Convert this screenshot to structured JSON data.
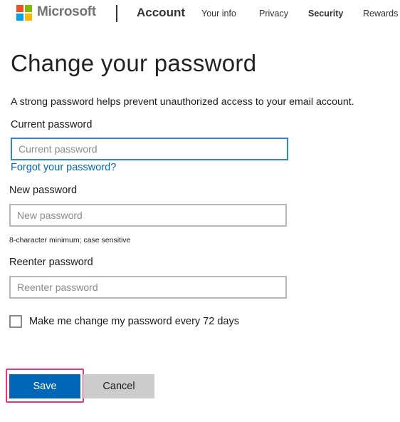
{
  "header": {
    "brand": "Microsoft",
    "section": "Account",
    "nav": [
      {
        "label": "Your info"
      },
      {
        "label": "Privacy"
      },
      {
        "label": "Security",
        "active": true
      },
      {
        "label": "Rewards"
      }
    ]
  },
  "page": {
    "title": "Change your password",
    "intro": "A strong password helps prevent unauthorized access to your email account."
  },
  "form": {
    "current": {
      "label": "Current password",
      "placeholder": "Current password",
      "value": ""
    },
    "forgot_link": "Forgot your password?",
    "new": {
      "label": "New password",
      "placeholder": "New password",
      "value": "",
      "hint": "8-character minimum; case sensitive"
    },
    "reenter": {
      "label": "Reenter password",
      "placeholder": "Reenter password",
      "value": ""
    },
    "expire_checkbox": {
      "label": "Make me change my password every 72 days",
      "checked": false
    },
    "save_label": "Save",
    "cancel_label": "Cancel"
  },
  "colors": {
    "accent": "#0067b8",
    "focus_border": "#2b88d8",
    "highlight": "#e8367a",
    "cancel_bg": "#cccccc",
    "logo": [
      "#f25022",
      "#7fba00",
      "#00a4ef",
      "#ffb900"
    ]
  },
  "icons": {
    "logo": "microsoft-logo-icon"
  }
}
